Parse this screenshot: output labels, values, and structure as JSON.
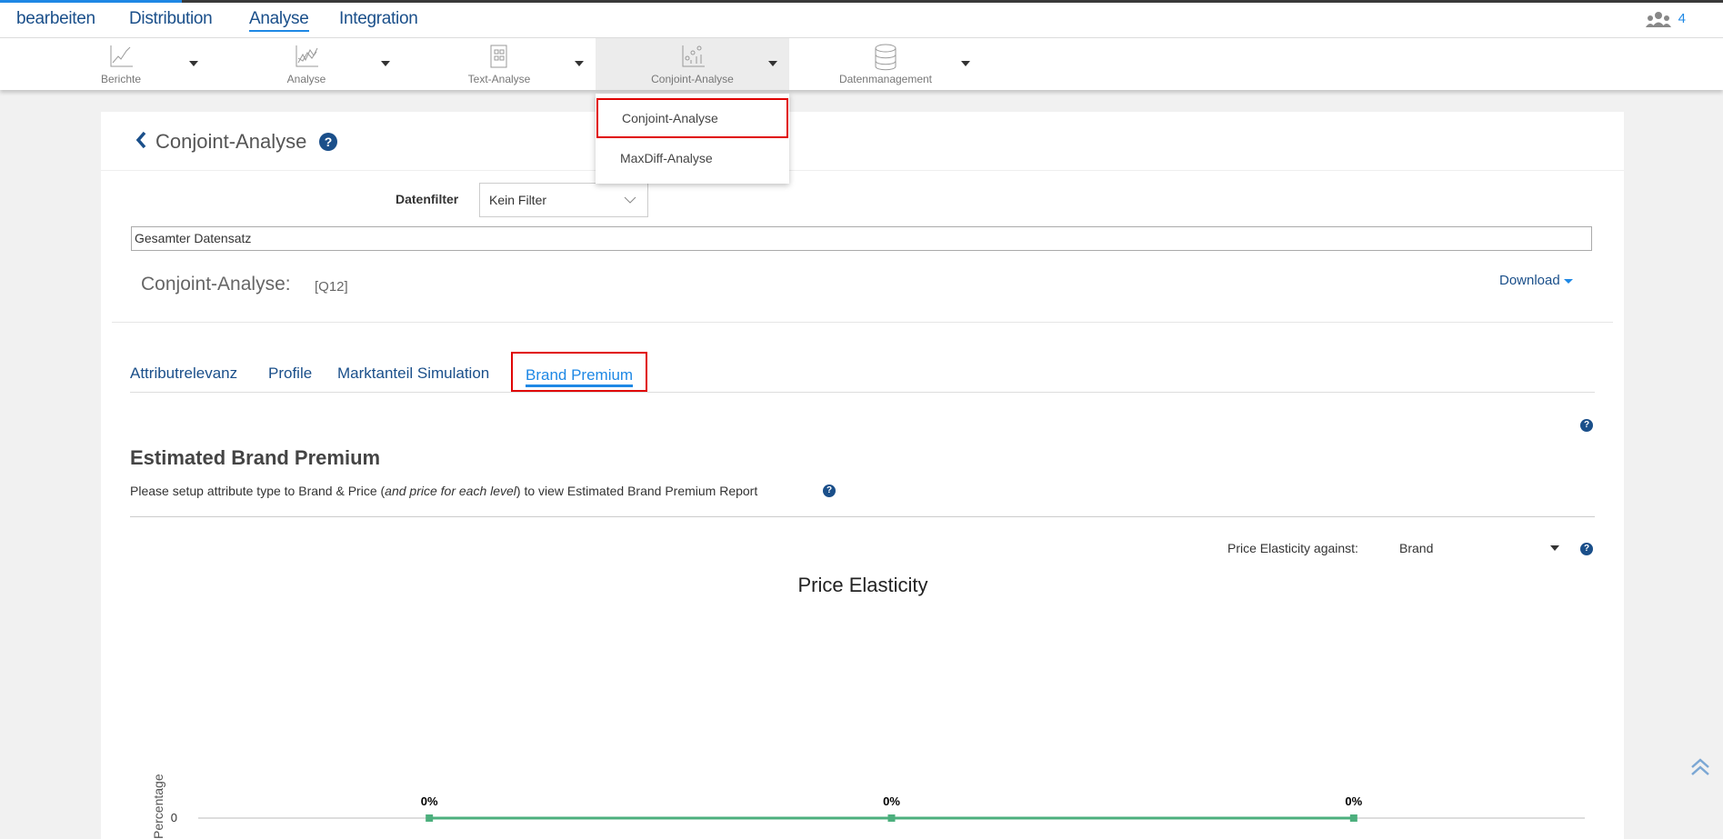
{
  "topnav": {
    "items": [
      "bearbeiten",
      "Distribution",
      "Analyse",
      "Integration"
    ],
    "active": "Analyse",
    "user_count": "4"
  },
  "toolbar": {
    "items": [
      "Berichte",
      "Analyse",
      "Text-Analyse",
      "Conjoint-Analyse",
      "Datenmanagement"
    ]
  },
  "dropdown": {
    "items": [
      "Conjoint-Analyse",
      "MaxDiff-Analyse"
    ]
  },
  "page": {
    "title": "Conjoint-Analyse",
    "filter_label": "Datenfilter",
    "filter_value": "Kein Filter",
    "dataset": "Gesamter Datensatz",
    "analysis_label": "Conjoint-Analyse:",
    "analysis_question": "[Q12]",
    "download": "Download"
  },
  "tabs": [
    "Attributrelevanz",
    "Profile",
    "Marktanteil Simulation",
    "Brand Premium"
  ],
  "section": {
    "title": "Estimated Brand Premium",
    "instruction_pre": "Please setup attribute type to Brand & Price (",
    "instruction_em": "and price for each level",
    "instruction_post": ") to view Estimated Brand Premium Report",
    "elasticity_label": "Price Elasticity against:",
    "elasticity_value": "Brand"
  },
  "chart_data": {
    "type": "line",
    "title": "Price Elasticity",
    "ylabel": "Percentage",
    "y_tick_labels": [
      "0"
    ],
    "series": [
      {
        "name": "Brand",
        "values": [
          0,
          0,
          0
        ],
        "labels": [
          "0%",
          "0%",
          "0%"
        ],
        "color": "#4caf7d"
      }
    ]
  }
}
